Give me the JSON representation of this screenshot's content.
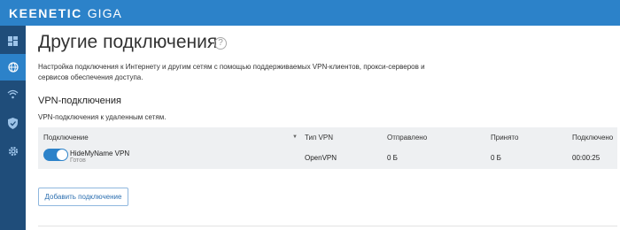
{
  "header": {
    "brand_primary": "KEENETIC",
    "brand_secondary": "GIGA",
    "background_color": "#2c82c9"
  },
  "sidebar": {
    "background_color": "#1f4d7a",
    "active_color": "#2c82c9",
    "items": [
      {
        "icon": "dashboard-icon",
        "active": false
      },
      {
        "icon": "globe-icon",
        "active": true
      },
      {
        "icon": "wifi-icon",
        "active": false
      },
      {
        "icon": "shield-icon",
        "active": false
      },
      {
        "icon": "gear-icon",
        "active": false
      }
    ]
  },
  "page": {
    "title": "Другие подключения",
    "help_icon": "?",
    "description": "Настройка подключения к Интернету и другим сетям с помощью поддерживаемых VPN-клиентов, прокси-серверов и сервисов обеспечения доступа."
  },
  "vpn": {
    "section_title": "VPN-подключения",
    "section_description": "VPN-подключения к удаленным сетям.",
    "columns": {
      "connection": "Подключение",
      "type": "Тип VPN",
      "sent": "Отправлено",
      "received": "Принято",
      "connected": "Подключено"
    },
    "rows": [
      {
        "name": "HideMyName VPN",
        "status": "Готов",
        "enabled": true,
        "type": "OpenVPN",
        "sent": "0 Б",
        "received": "0 Б",
        "connected": "00:00:25"
      }
    ],
    "add_button_label": "Добавить подключение"
  }
}
